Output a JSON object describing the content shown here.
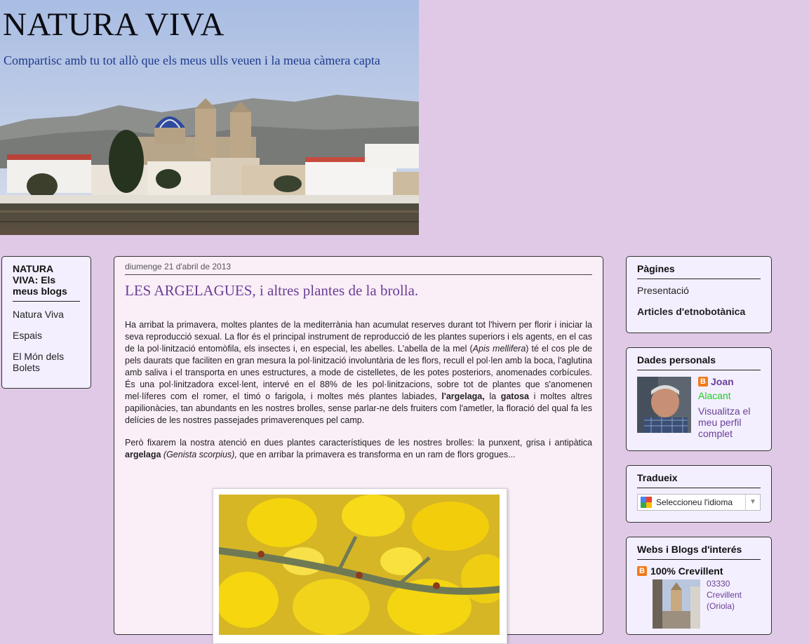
{
  "header": {
    "title": "NATURA VIVA",
    "description": "Compartisc amb tu tot allò que els meus ulls veuen i la meua càmera capta"
  },
  "left_widget": {
    "title": "NATURA VIVA: Els meus blogs",
    "items": [
      "Natura Viva",
      "Espais",
      "El Món dels Bolets"
    ]
  },
  "post": {
    "date": "diumenge 21 d'abril de 2013",
    "title": "LES ARGELAGUES, i altres plantes de la brolla.",
    "p1": {
      "a": "Ha arribat la primavera, moltes plantes de la mediterrània han acumulat reserves durant tot l'hivern per florir i iniciar la seva reproducció sexual. La flor és el principal instrument de reproducció de les plantes superiors i els agents, en el cas de la pol·linització entomòfila, els insectes i, en especial, les abelles. L'abella de la mel (",
      "b": "Apis mellifera",
      "c": ") té el cos ple de pels daurats que faciliten en gran mesura la pol·linització involuntària de les flors, recull el pol·len amb la boca, l'aglutina amb saliva i el transporta en unes estructures, a mode de cistelletes, de les potes posteriors, anomenades corbícules. És una pol·linitzadora excel·lent, intervé en el 88% de les pol·linitzacions, sobre tot de plantes que s'anomenen mel·líferes com el romer, el timó o farigola, i moltes més plantes labiades, ",
      "d": "l'argelaga,",
      "e": " la ",
      "f": "gatosa",
      "g": " i moltes altres papilionàcies, tan abundants en les nostres brolles, sense parlar-ne dels fruiters com l'ametler, la floració del qual fa les delícies de les nostres passejades primaverenques pel camp."
    },
    "p2": {
      "a": "Però fixarem la nostra atenció en dues plantes característiques de les nostres brolles: la punxent, grisa i antipàtica ",
      "b": "argelaga",
      "c": " ",
      "d": "(Genista scorpius),",
      "e": " que en arribar la primavera es transforma en un ram de flors grogues..."
    }
  },
  "pages_widget": {
    "title": "Pàgines",
    "items": [
      "Presentació",
      "Articles d'etnobotànica"
    ]
  },
  "profile_widget": {
    "title": "Dades personals",
    "name": "Joan",
    "location": "Alacant",
    "link": "Visualitza el meu perfil complet",
    "blogger_glyph": "B"
  },
  "translate_widget": {
    "title": "Tradueix",
    "select_value": "Seleccioneu l'idioma",
    "arrow": "▼"
  },
  "webs_widget": {
    "title": "Webs i Blogs d'interés",
    "item_title": "100% Crevillent",
    "item_snippet": "03330 Crevillent (Oriola)",
    "blogger_glyph": "B"
  },
  "colors": {
    "background": "#e0c9e6",
    "post_title": "#6a3e96",
    "location_green": "#22cc22",
    "blogger_orange": "#f27a1a"
  }
}
